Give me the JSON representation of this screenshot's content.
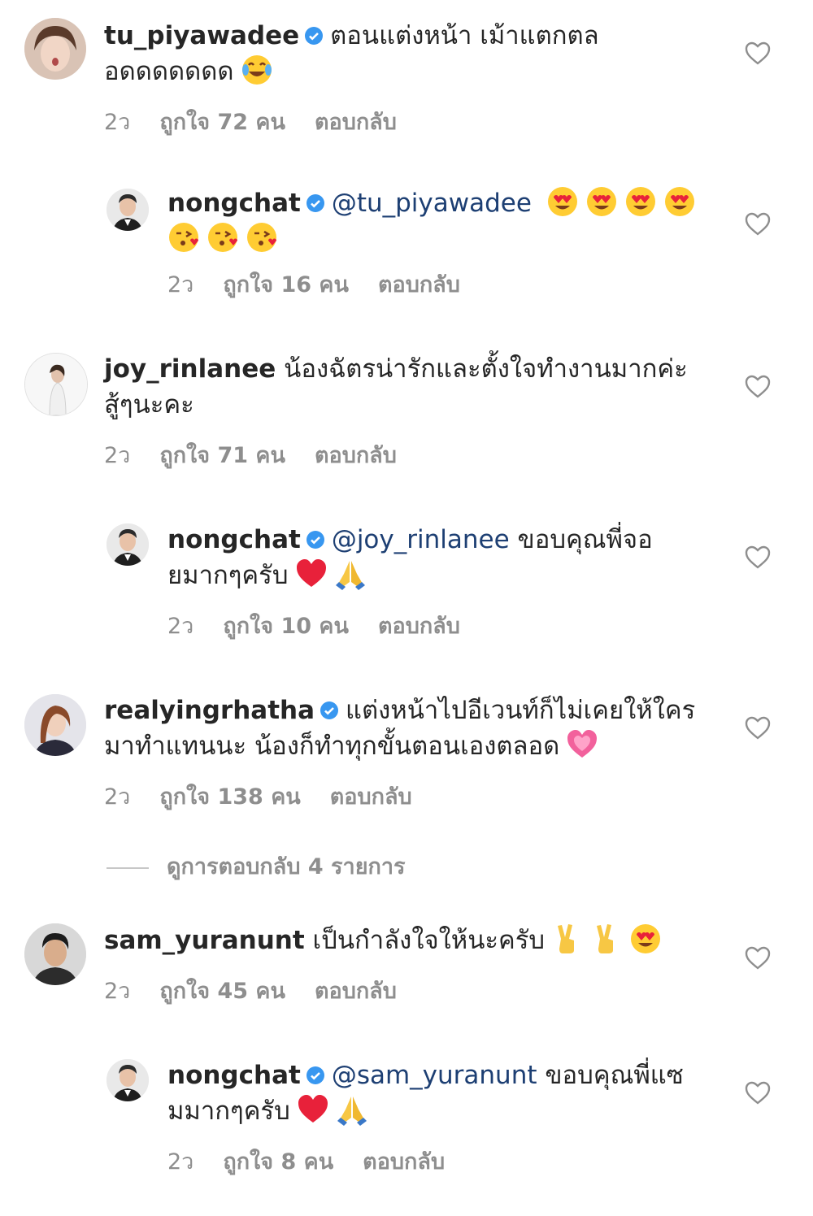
{
  "comments": [
    {
      "user": "tu_piyawadee",
      "text": "ตอนแต่งหน้า เม้าแตกตล อดดดดดดด",
      "emojis": [
        "joy"
      ],
      "age": "2ว",
      "likes": "ถูกใจ 72 คน",
      "reply": "ตอบกลับ",
      "verified": true
    },
    {
      "user": "nongchat",
      "mention": "@tu_piyawadee",
      "text": "",
      "emojis": [
        "heart-eyes",
        "heart-eyes",
        "heart-eyes",
        "heart-eyes",
        "kiss",
        "kiss",
        "kiss"
      ],
      "age": "2ว",
      "likes": "ถูกใจ 16 คน",
      "reply": "ตอบกลับ",
      "verified": true
    },
    {
      "user": "joy_rinlanee",
      "text": "น้องฉัตรน่ารักและตั้งใจทำงานมากค่ะ สู้ๆนะคะ",
      "emojis": [],
      "age": "2ว",
      "likes": "ถูกใจ 71 คน",
      "reply": "ตอบกลับ",
      "verified": false
    },
    {
      "user": "nongchat",
      "mention": "@joy_rinlanee",
      "text": "ขอบคุณพี่จอยมากๆครับ",
      "emojis": [
        "red-heart",
        "pray"
      ],
      "age": "2ว",
      "likes": "ถูกใจ 10 คน",
      "reply": "ตอบกลับ",
      "verified": true
    },
    {
      "user": "realyingrhatha",
      "text": "แต่งหน้าไปอีเวนท์ก็ไม่เคยให้ใครมาทำแทนนะ น้องก็ทำทุกขั้นตอนเองตลอด",
      "emojis": [
        "pink-heart"
      ],
      "age": "2ว",
      "likes": "ถูกใจ 138 คน",
      "reply": "ตอบกลับ",
      "verified": true
    },
    {
      "user": "sam_yuranunt",
      "text": "เป็นกำลังใจให้นะครับ",
      "emojis": [
        "victory",
        "victory",
        "heart-eyes"
      ],
      "age": "2ว",
      "likes": "ถูกใจ 45 คน",
      "reply": "ตอบกลับ",
      "verified": false
    },
    {
      "user": "nongchat",
      "mention": "@sam_yuranunt",
      "text": "ขอบคุณพี่แซมมากๆครับ",
      "emojis": [
        "red-heart",
        "pray"
      ],
      "age": "2ว",
      "likes": "ถูกใจ 8 คน",
      "reply": "ตอบกลับ",
      "verified": true
    }
  ],
  "view_replies": "ดูการตอบกลับ 4 รายการ",
  "colors": {
    "verified": "#3897f0",
    "mention": "#1d3f73",
    "meta": "#8e8e8e"
  }
}
